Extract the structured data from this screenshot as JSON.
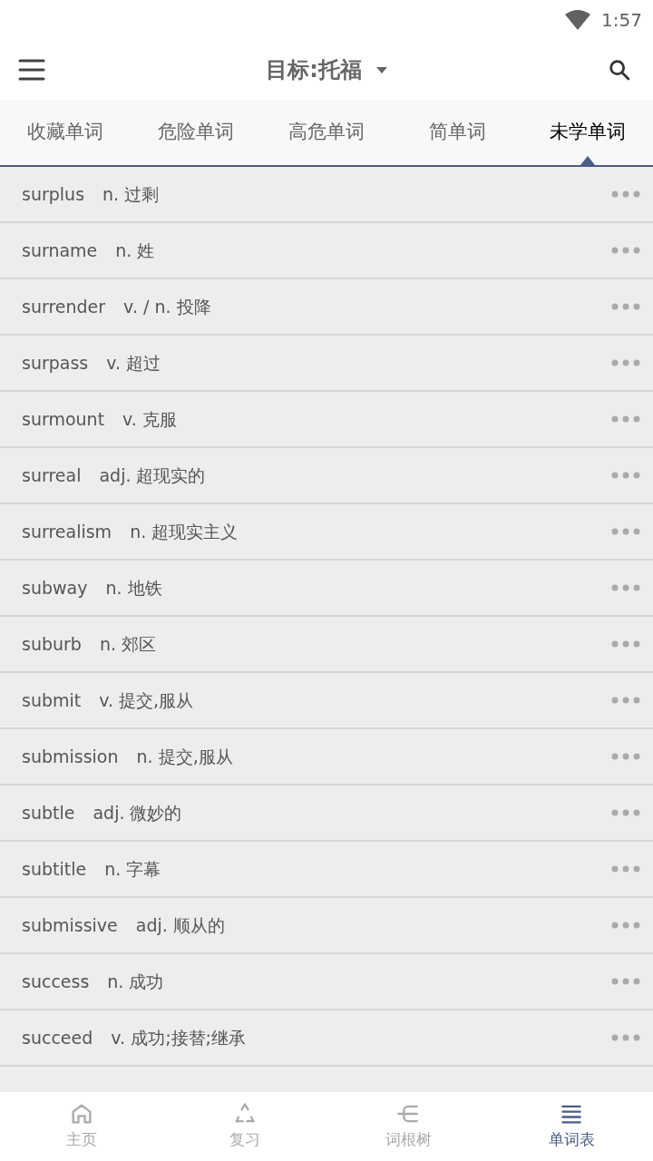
{
  "status_bar": {
    "time": "1:57"
  },
  "app_bar": {
    "title": "目标:托福"
  },
  "tabs": [
    {
      "label": "收藏单词",
      "selected": false
    },
    {
      "label": "危险单词",
      "selected": false
    },
    {
      "label": "高危单词",
      "selected": false
    },
    {
      "label": "简单词",
      "selected": false
    },
    {
      "label": "未学单词",
      "selected": true
    }
  ],
  "words": [
    {
      "word": "surplus",
      "meaning": "n. 过剩"
    },
    {
      "word": "surname",
      "meaning": "n. 姓"
    },
    {
      "word": "surrender",
      "meaning": "v. / n. 投降"
    },
    {
      "word": "surpass",
      "meaning": "v. 超过"
    },
    {
      "word": "surmount",
      "meaning": "v. 克服"
    },
    {
      "word": "surreal",
      "meaning": "adj. 超现实的"
    },
    {
      "word": "surrealism",
      "meaning": "n. 超现实主义"
    },
    {
      "word": "subway",
      "meaning": "n. 地铁"
    },
    {
      "word": "suburb",
      "meaning": "n. 郊区"
    },
    {
      "word": "submit",
      "meaning": "v. 提交,服从"
    },
    {
      "word": "submission",
      "meaning": "n. 提交,服从"
    },
    {
      "word": "subtle",
      "meaning": "adj. 微妙的"
    },
    {
      "word": "subtitle",
      "meaning": "n. 字幕"
    },
    {
      "word": "submissive",
      "meaning": "adj. 顺从的"
    },
    {
      "word": "success",
      "meaning": "n. 成功"
    },
    {
      "word": "succeed",
      "meaning": "v. 成功;接替;继承"
    }
  ],
  "bottom_nav": [
    {
      "kind": "home",
      "label": "主页",
      "selected": false
    },
    {
      "kind": "review",
      "label": "复习",
      "selected": false
    },
    {
      "kind": "tree",
      "label": "词根树",
      "selected": false
    },
    {
      "kind": "list",
      "label": "单词表",
      "selected": true
    }
  ]
}
